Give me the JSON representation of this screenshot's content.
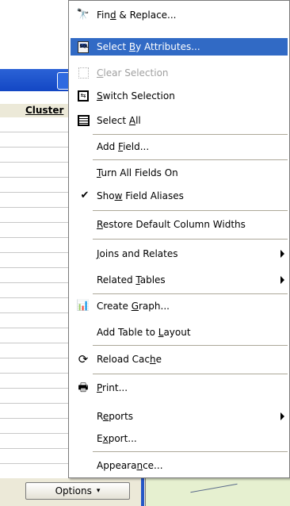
{
  "window": {
    "column_header": "Cluster"
  },
  "options_button": {
    "label": "Options",
    "arrow": "▾"
  },
  "menu": {
    "items": [
      {
        "pre": "Fin",
        "key": "d",
        "post": " & Replace...",
        "icon": "binoculars-icon",
        "state": "normal"
      },
      {
        "pre": "Select ",
        "key": "B",
        "post": "y Attributes...",
        "icon": "sql-query-icon",
        "state": "highlighted"
      },
      {
        "pre": "",
        "key": "C",
        "post": "lear Selection",
        "icon": "clear-selection-icon",
        "state": "disabled"
      },
      {
        "pre": "",
        "key": "S",
        "post": "witch Selection",
        "icon": "switch-selection-icon",
        "state": "normal"
      },
      {
        "pre": "Select ",
        "key": "A",
        "post": "ll",
        "icon": "select-all-icon",
        "state": "normal"
      },
      {
        "pre": "Add ",
        "key": "F",
        "post": "ield...",
        "icon": "",
        "state": "normal"
      },
      {
        "pre": "",
        "key": "T",
        "post": "urn All Fields On",
        "icon": "",
        "state": "normal"
      },
      {
        "pre": "Sho",
        "key": "w",
        "post": " Field Aliases",
        "icon": "checkmark-icon",
        "state": "checked"
      },
      {
        "pre": "",
        "key": "R",
        "post": "estore Default Column Widths",
        "icon": "",
        "state": "normal"
      },
      {
        "pre": "",
        "key": "J",
        "post": "oins and Relates",
        "icon": "",
        "state": "submenu"
      },
      {
        "pre": "Related ",
        "key": "T",
        "post": "ables",
        "icon": "",
        "state": "submenu"
      },
      {
        "pre": "Create ",
        "key": "G",
        "post": "raph...",
        "icon": "graph-icon",
        "state": "normal"
      },
      {
        "pre": "Add Table to ",
        "key": "L",
        "post": "ayout",
        "icon": "",
        "state": "normal"
      },
      {
        "pre": "Reload Cac",
        "key": "h",
        "post": "e",
        "icon": "reload-icon",
        "state": "normal"
      },
      {
        "pre": "",
        "key": "P",
        "post": "rint...",
        "icon": "printer-icon",
        "state": "normal"
      },
      {
        "pre": "R",
        "key": "e",
        "post": "ports",
        "icon": "",
        "state": "submenu"
      },
      {
        "pre": "E",
        "key": "x",
        "post": "port...",
        "icon": "",
        "state": "normal"
      },
      {
        "pre": "Appeara",
        "key": "n",
        "post": "ce...",
        "icon": "",
        "state": "normal"
      }
    ],
    "highlight_color": "#316ac5",
    "disabled_color": "#a0a0a0"
  }
}
